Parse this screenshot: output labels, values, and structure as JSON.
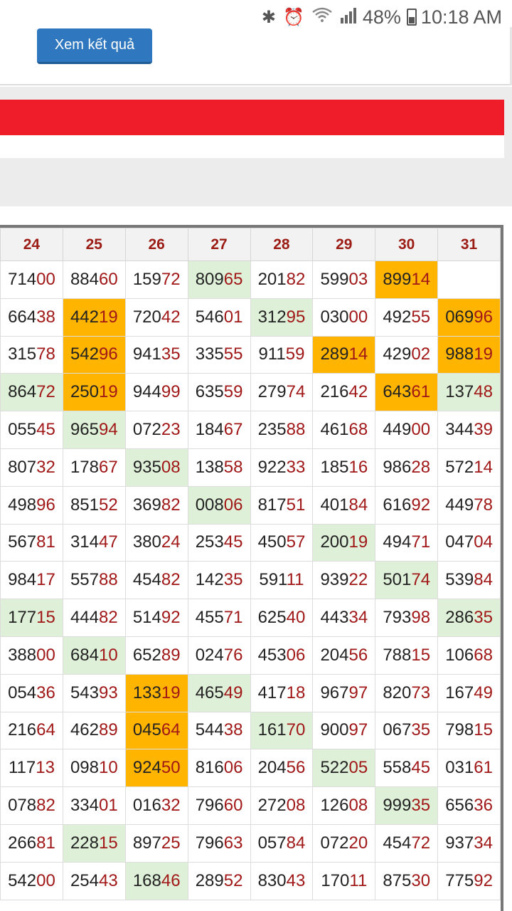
{
  "status_bar": {
    "battery": "48%",
    "time": "10:18 AM",
    "icons": [
      "bluetooth-icon",
      "alarm-icon",
      "wifi-icon",
      "signal-icon",
      "battery-icon"
    ]
  },
  "button": {
    "label": "Xem kết quả"
  },
  "colors": {
    "red_bar": "#ef1c2a",
    "button": "#2f78bf",
    "highlight_orange": "#ffb400",
    "highlight_green": "#dff0d8",
    "digit_red": "#a01818"
  },
  "table": {
    "headers": [
      "24",
      "25",
      "26",
      "27",
      "28",
      "29",
      "30",
      "31"
    ],
    "rows": [
      [
        [
          "71400",
          ""
        ],
        [
          "88460",
          ""
        ],
        [
          "15972",
          ""
        ],
        [
          "80965",
          "g"
        ],
        [
          "20182",
          ""
        ],
        [
          "59903",
          ""
        ],
        [
          "89914",
          "o"
        ],
        [
          "",
          ""
        ]
      ],
      [
        [
          "66438",
          ""
        ],
        [
          "44219",
          "o"
        ],
        [
          "72042",
          ""
        ],
        [
          "54601",
          ""
        ],
        [
          "31295",
          "g"
        ],
        [
          "03000",
          ""
        ],
        [
          "49255",
          ""
        ],
        [
          "06996",
          "o"
        ]
      ],
      [
        [
          "31578",
          ""
        ],
        [
          "54296",
          "o"
        ],
        [
          "94135",
          ""
        ],
        [
          "33555",
          ""
        ],
        [
          "91159",
          ""
        ],
        [
          "28914",
          "o"
        ],
        [
          "42902",
          ""
        ],
        [
          "98819",
          "o"
        ]
      ],
      [
        [
          "86472",
          "g"
        ],
        [
          "25019",
          "o"
        ],
        [
          "94499",
          ""
        ],
        [
          "63559",
          ""
        ],
        [
          "27974",
          ""
        ],
        [
          "21642",
          ""
        ],
        [
          "64361",
          "o"
        ],
        [
          "13748",
          "g"
        ]
      ],
      [
        [
          "05545",
          ""
        ],
        [
          "96594",
          "g"
        ],
        [
          "07223",
          ""
        ],
        [
          "18467",
          ""
        ],
        [
          "23588",
          ""
        ],
        [
          "46168",
          ""
        ],
        [
          "44900",
          ""
        ],
        [
          "34439",
          ""
        ]
      ],
      [
        [
          "80732",
          ""
        ],
        [
          "17867",
          ""
        ],
        [
          "93508",
          "g"
        ],
        [
          "13858",
          ""
        ],
        [
          "92233",
          ""
        ],
        [
          "18516",
          ""
        ],
        [
          "98628",
          ""
        ],
        [
          "57214",
          ""
        ]
      ],
      [
        [
          "49896",
          ""
        ],
        [
          "85152",
          ""
        ],
        [
          "36982",
          ""
        ],
        [
          "00806",
          "g"
        ],
        [
          "81751",
          ""
        ],
        [
          "40184",
          ""
        ],
        [
          "61692",
          ""
        ],
        [
          "44978",
          ""
        ]
      ],
      [
        [
          "56781",
          ""
        ],
        [
          "31447",
          ""
        ],
        [
          "38024",
          ""
        ],
        [
          "25345",
          ""
        ],
        [
          "45057",
          ""
        ],
        [
          "20019",
          "g"
        ],
        [
          "49471",
          ""
        ],
        [
          "04704",
          ""
        ]
      ],
      [
        [
          "98417",
          ""
        ],
        [
          "55788",
          ""
        ],
        [
          "45482",
          ""
        ],
        [
          "14235",
          ""
        ],
        [
          "59111",
          ""
        ],
        [
          "93922",
          ""
        ],
        [
          "50174",
          "g"
        ],
        [
          "53984",
          ""
        ]
      ],
      [
        [
          "17715",
          "g"
        ],
        [
          "44482",
          ""
        ],
        [
          "51492",
          ""
        ],
        [
          "45571",
          ""
        ],
        [
          "62540",
          ""
        ],
        [
          "44334",
          ""
        ],
        [
          "79398",
          ""
        ],
        [
          "28635",
          "g"
        ]
      ],
      [
        [
          "38800",
          ""
        ],
        [
          "68410",
          "g"
        ],
        [
          "65289",
          ""
        ],
        [
          "02476",
          ""
        ],
        [
          "45306",
          ""
        ],
        [
          "20456",
          ""
        ],
        [
          "78815",
          ""
        ],
        [
          "10668",
          ""
        ]
      ],
      [
        [
          "05436",
          ""
        ],
        [
          "54393",
          ""
        ],
        [
          "13319",
          "o"
        ],
        [
          "46549",
          "g"
        ],
        [
          "41718",
          ""
        ],
        [
          "96797",
          ""
        ],
        [
          "82073",
          ""
        ],
        [
          "16749",
          ""
        ]
      ],
      [
        [
          "21664",
          ""
        ],
        [
          "46289",
          ""
        ],
        [
          "04564",
          "o"
        ],
        [
          "54438",
          ""
        ],
        [
          "16170",
          "g"
        ],
        [
          "90097",
          ""
        ],
        [
          "06735",
          ""
        ],
        [
          "79815",
          ""
        ]
      ],
      [
        [
          "11713",
          ""
        ],
        [
          "09810",
          ""
        ],
        [
          "92450",
          "o"
        ],
        [
          "81606",
          ""
        ],
        [
          "20456",
          ""
        ],
        [
          "52205",
          "g"
        ],
        [
          "55845",
          ""
        ],
        [
          "03161",
          ""
        ]
      ],
      [
        [
          "07882",
          ""
        ],
        [
          "33401",
          ""
        ],
        [
          "01632",
          ""
        ],
        [
          "79660",
          ""
        ],
        [
          "27208",
          ""
        ],
        [
          "12608",
          ""
        ],
        [
          "99935",
          "g"
        ],
        [
          "65636",
          ""
        ]
      ],
      [
        [
          "26681",
          ""
        ],
        [
          "22815",
          "g"
        ],
        [
          "89725",
          ""
        ],
        [
          "79663",
          ""
        ],
        [
          "05784",
          ""
        ],
        [
          "07220",
          ""
        ],
        [
          "45472",
          ""
        ],
        [
          "93734",
          ""
        ]
      ],
      [
        [
          "54200",
          ""
        ],
        [
          "25443",
          ""
        ],
        [
          "16846",
          "g"
        ],
        [
          "28952",
          ""
        ],
        [
          "83043",
          ""
        ],
        [
          "17011",
          ""
        ],
        [
          "87530",
          ""
        ],
        [
          "77592",
          ""
        ]
      ]
    ]
  }
}
